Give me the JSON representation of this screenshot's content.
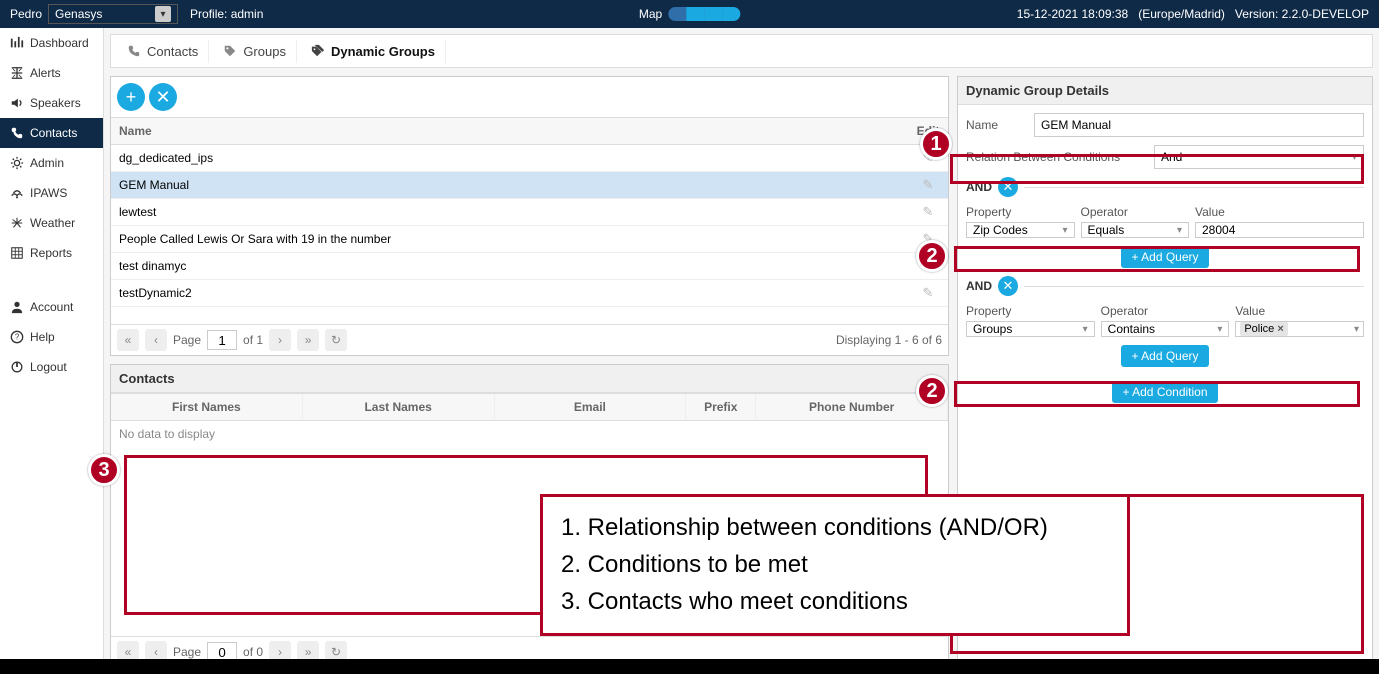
{
  "topbar": {
    "user": "Pedro",
    "org": "Genasys",
    "profile": "Profile: admin",
    "map_label": "Map",
    "datetime": "15-12-2021 18:09:38",
    "timezone": "(Europe/Madrid)",
    "version": "Version: 2.2.0-DEVELOP"
  },
  "sidebar": {
    "items": [
      {
        "label": "Dashboard",
        "icon": "dashboard-icon"
      },
      {
        "label": "Alerts",
        "icon": "alerts-icon"
      },
      {
        "label": "Speakers",
        "icon": "speakers-icon"
      },
      {
        "label": "Contacts",
        "icon": "contacts-icon"
      },
      {
        "label": "Admin",
        "icon": "admin-icon"
      },
      {
        "label": "IPAWS",
        "icon": "ipaws-icon"
      },
      {
        "label": "Weather",
        "icon": "weather-icon"
      },
      {
        "label": "Reports",
        "icon": "reports-icon"
      }
    ],
    "items2": [
      {
        "label": "Account",
        "icon": "account-icon"
      },
      {
        "label": "Help",
        "icon": "help-icon"
      },
      {
        "label": "Logout",
        "icon": "logout-icon"
      }
    ]
  },
  "tabs": {
    "items": [
      {
        "label": "Contacts"
      },
      {
        "label": "Groups"
      },
      {
        "label": "Dynamic Groups"
      }
    ]
  },
  "groups": {
    "header_name": "Name",
    "header_edit": "Edit",
    "rows": [
      "dg_dedicated_ips",
      "GEM Manual",
      "lewtest",
      "People Called Lewis Or Sara with 19 in the number",
      "test dinamyc",
      "testDynamic2"
    ],
    "page_label": "Page",
    "page_value": "1",
    "of_label": "of 1",
    "display_label": "Displaying 1 - 6 of 6"
  },
  "contacts": {
    "title": "Contacts",
    "columns": [
      "First Names",
      "Last Names",
      "Email",
      "Prefix",
      "Phone Number"
    ],
    "empty": "No data to display",
    "page_label": "Page",
    "page_value": "0",
    "of_label": "of 0"
  },
  "details": {
    "title": "Dynamic Group Details",
    "name_label": "Name",
    "name_value": "GEM Manual",
    "relation_label": "Relation Between Conditions",
    "relation_value": "And",
    "and_label": "AND",
    "property_label": "Property",
    "operator_label": "Operator",
    "value_label": "Value",
    "add_query": "+ Add Query",
    "add_condition": "+ Add Condition",
    "cond1": {
      "property": "Zip Codes",
      "operator": "Equals",
      "value": "28004"
    },
    "cond2": {
      "property": "Groups",
      "operator": "Contains",
      "tag": "Police"
    }
  },
  "legend": {
    "l1": "1. Relationship between conditions (AND/OR)",
    "l2": "2. Conditions to be met",
    "l3": "3. Contacts who meet conditions"
  }
}
